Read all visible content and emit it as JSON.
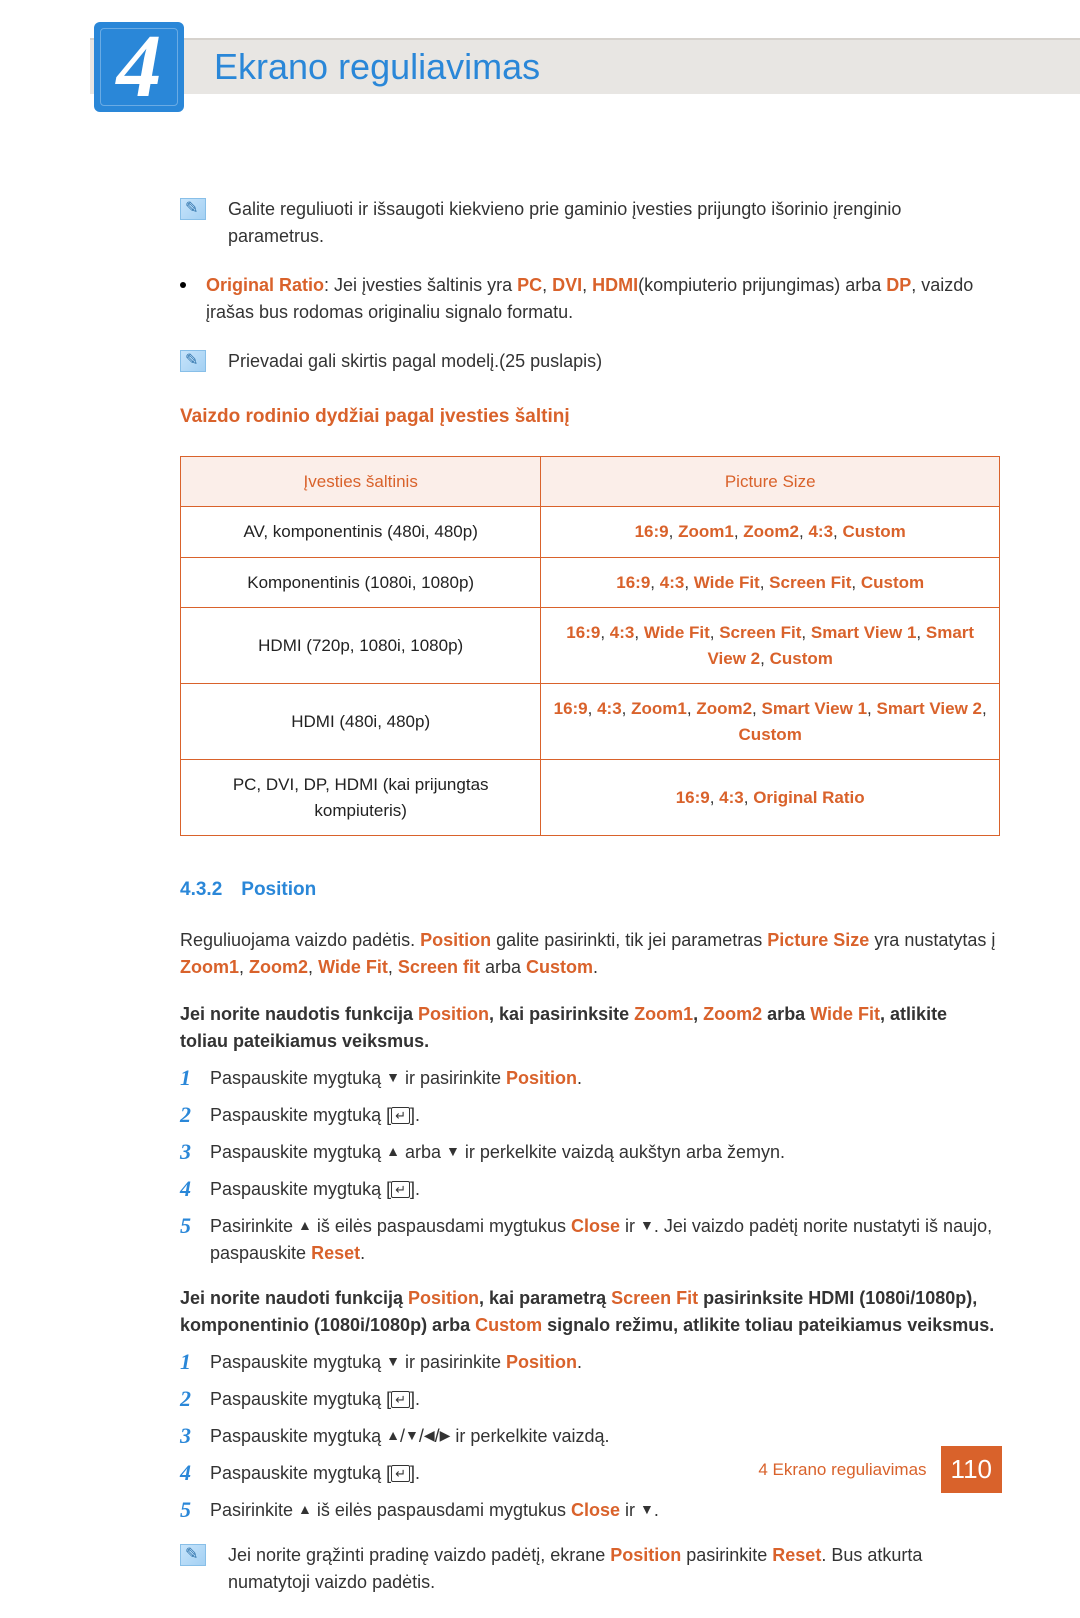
{
  "chapter": {
    "num": "4",
    "title": "Ekrano reguliavimas"
  },
  "note1": "Galite reguliuoti ir išsaugoti kiekvieno prie gaminio įvesties prijungto išorinio įrenginio parametrus.",
  "bullet1": {
    "lead": "Original Ratio",
    "p1": ": Jei įvesties šaltinis yra ",
    "pc": "PC",
    "c1": ", ",
    "dvi": "DVI",
    "c2": ", ",
    "hdmi": "HDMI",
    "mid": "(kompiuterio prijungimas) arba ",
    "dp": "DP",
    "tail": ", vaizdo įrašas bus rodomas originaliu signalo formatu."
  },
  "note2": "Prievadai gali skirtis pagal modelį.(25 puslapis)",
  "tableHead": "Vaizdo rodinio dydžiai pagal įvesties šaltinį",
  "th1": "Įvesties šaltinis",
  "th2": "Picture Size",
  "rows": [
    {
      "l": "AV, komponentinis (480i, 480p)",
      "r": [
        "16:9",
        ", ",
        "Zoom1",
        ", ",
        "Zoom2",
        ", ",
        "4:3",
        ", ",
        "Custom"
      ]
    },
    {
      "l": "Komponentinis (1080i, 1080p)",
      "r": [
        "16:9",
        ", ",
        "4:3",
        ", ",
        "Wide Fit",
        ", ",
        "Screen Fit",
        ", ",
        "Custom"
      ]
    },
    {
      "l": "HDMI (720p, 1080i, 1080p)",
      "r": [
        "16:9",
        ", ",
        "4:3",
        ", ",
        "Wide Fit",
        ", ",
        "Screen Fit",
        ", ",
        " Smart View 1",
        ", ",
        "Smart View 2",
        ", ",
        "Custom"
      ]
    },
    {
      "l": "HDMI (480i, 480p)",
      "r": [
        "16:9",
        ", ",
        "4:3",
        ", ",
        "Zoom1",
        ", ",
        "Zoom2",
        ", ",
        " Smart View 1",
        ", ",
        "Smart View 2",
        ", ",
        "Custom"
      ]
    },
    {
      "l": "PC, DVI, DP, HDMI (kai prijungtas kompiuteris)",
      "r": [
        "16:9",
        ", ",
        "4:3",
        ", ",
        "Original Ratio"
      ]
    }
  ],
  "sec": {
    "num": "4.3.2",
    "title": "Position"
  },
  "posPara": {
    "a": "Reguliuojama vaizdo padėtis. ",
    "b": "Position",
    "c": " galite pasirinkti, tik jei parametras ",
    "d": "Picture Size",
    "e": " yra nustatytas į ",
    "f": "Zoom1",
    "g": ", ",
    "h": "Zoom2",
    "i": ", ",
    "j": "Wide Fit",
    "k": ", ",
    "l": "Screen fit",
    "m": " arba ",
    "n": "Custom",
    "o": "."
  },
  "bold1": {
    "a": "Jei norite naudotis funkcija ",
    "b": "Position",
    "c": ", kai pasirinksite ",
    "d": "Zoom1",
    "e": ", ",
    "f": "Zoom2",
    "g": " arba ",
    "h": "Wide Fit",
    "i": ", atlikite toliau pateikiamus veiksmus."
  },
  "stepsA": [
    {
      "n": "1",
      "pre": "Paspauskite mygtuką ",
      "sym": "▼",
      "mid": " ir pasirinkite ",
      "kw": "Position",
      "post": "."
    },
    {
      "n": "2",
      "pre": "Paspauskite mygtuką [",
      "enter": "↵",
      "post": "]."
    },
    {
      "n": "3",
      "pre": "Paspauskite mygtuką ",
      "sym": "▲",
      "mid": " arba ",
      "sym2": "▼",
      "post": " ir perkelkite vaizdą aukštyn arba žemyn."
    },
    {
      "n": "4",
      "pre": "Paspauskite mygtuką [",
      "enter": "↵",
      "post": "]."
    },
    {
      "n": "5",
      "pre": "Pasirinkite ",
      "kw": "Close",
      "mid": " iš eilės paspausdami mygtukus ",
      "sym": "▲",
      "mid2": " ir ",
      "sym2": "▼",
      "post": ". Jei vaizdo padėtį norite nustatyti iš naujo, paspauskite ",
      "kw2": "Reset",
      "end": "."
    }
  ],
  "bold2": {
    "a": "Jei norite naudoti funkciją ",
    "b": "Position",
    "c": ", kai parametrą ",
    "d": "Screen Fit",
    "e": " pasirinksite HDMI (1080i/1080p), komponentinio (1080i/1080p) arba ",
    "f": "Custom",
    "g": " signalo režimu, atlikite toliau pateikiamus veiksmus."
  },
  "stepsB": [
    {
      "n": "1",
      "pre": "Paspauskite mygtuką ",
      "sym": "▼",
      "mid": " ir pasirinkite ",
      "kw": "Position",
      "post": "."
    },
    {
      "n": "2",
      "pre": "Paspauskite mygtuką [",
      "enter": "↵",
      "post": "]."
    },
    {
      "n": "3",
      "pre": "Paspauskite mygtuką ",
      "sym": "▲",
      "s1": "/",
      "sym2": "▼",
      "s2": "/",
      "sym3": "◀",
      "s3": "/",
      "sym4": "▶",
      "post": " ir perkelkite vaizdą."
    },
    {
      "n": "4",
      "pre": "Paspauskite mygtuką [",
      "enter": "↵",
      "post": "]."
    },
    {
      "n": "5",
      "pre": "Pasirinkite ",
      "kw": "Close",
      "mid": " iš eilės paspausdami mygtukus ",
      "sym": "▲",
      "mid2": " ir ",
      "sym2": "▼",
      "post": "."
    }
  ],
  "note3": {
    "a": "Jei norite grąžinti pradinę vaizdo padėtį, ekrane ",
    "b": "Position",
    "c": " pasirinkite ",
    "d": "Reset",
    "e": ". Bus atkurta numatytoji vaizdo padėtis."
  },
  "footer": {
    "label": "4 Ekrano reguliavimas",
    "page": "110"
  }
}
